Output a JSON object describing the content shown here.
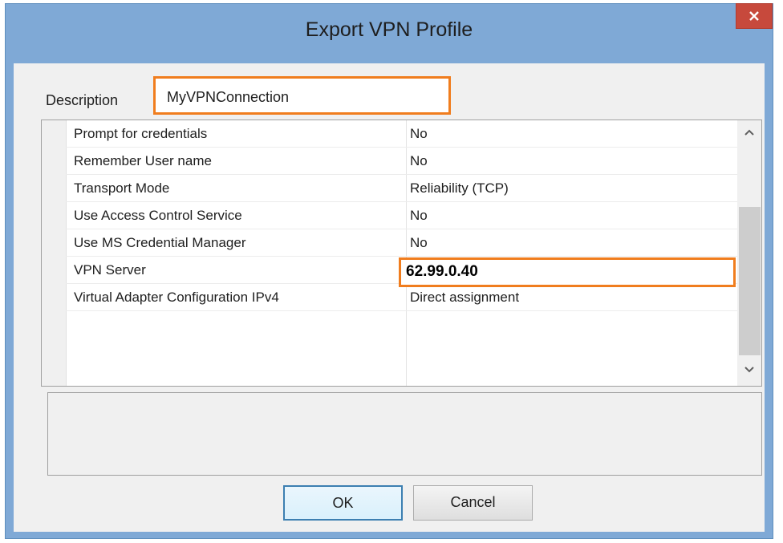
{
  "window": {
    "title": "Export VPN Profile",
    "close_icon": "close-icon"
  },
  "description": {
    "label": "Description",
    "value": "MyVPNConnection"
  },
  "properties": [
    {
      "name": "Prompt for credentials",
      "value": "No"
    },
    {
      "name": "Remember User name",
      "value": "No"
    },
    {
      "name": "Transport Mode",
      "value": "Reliability (TCP)"
    },
    {
      "name": "Use Access Control Service",
      "value": "No"
    },
    {
      "name": "Use MS Credential Manager",
      "value": "No"
    },
    {
      "name": "VPN Server",
      "value": "62.99.0.40"
    },
    {
      "name": "Virtual Adapter Configuration IPv4",
      "value": "Direct assignment"
    }
  ],
  "buttons": {
    "ok": "OK",
    "cancel": "Cancel"
  },
  "colors": {
    "titlebar": "#7fa9d6",
    "close": "#c7493c",
    "highlight": "#f07d1e"
  }
}
